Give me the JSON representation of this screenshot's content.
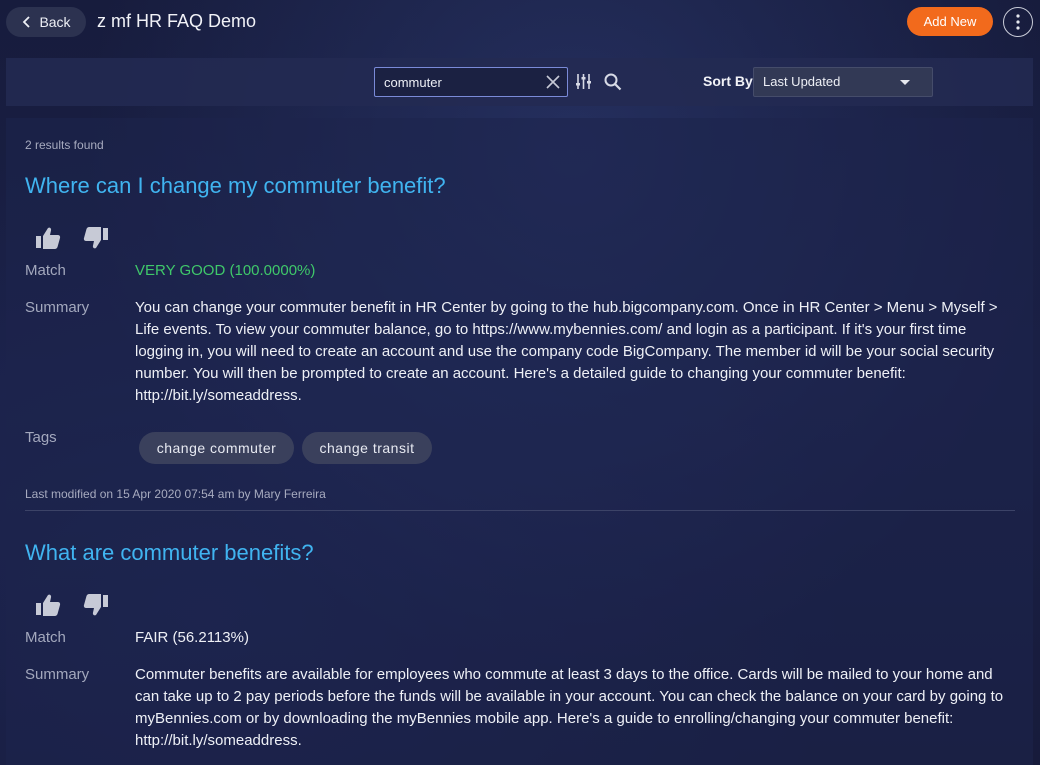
{
  "header": {
    "back_label": "Back",
    "title": "z mf HR FAQ Demo",
    "add_new_label": "Add New"
  },
  "toolbar": {
    "search_value": "commuter",
    "sort_by_label": "Sort By",
    "sort_value": "Last Updated"
  },
  "results": {
    "count_text": "2 results found",
    "items": [
      {
        "question": "Where can I change my commuter benefit?",
        "match_label": "Match",
        "match_value": "VERY GOOD (100.0000%)",
        "summary_label": "Summary",
        "summary": "You can change your commuter benefit in HR Center by going to the hub.bigcompany.com. Once in HR Center > Menu > Myself > Life events. To view your commuter balance, go to https://www.mybennies.com/ and login as a participant. If it's your first time logging in, you will need to create an account and use the company code BigCompany. The member id will be your social security number. You will then be prompted to create an account. Here's a detailed guide to changing your commuter benefit: http://bit.ly/someaddress.",
        "tags_label": "Tags",
        "tags": [
          "change commuter",
          "change transit"
        ],
        "modified": "Last modified on 15 Apr 2020 07:54 am by Mary Ferreira"
      },
      {
        "question": "What are commuter benefits?",
        "match_label": "Match",
        "match_value": "FAIR (56.2113%)",
        "summary_label": "Summary",
        "summary": "Commuter benefits are available for employees who commute at least 3 days to the office. Cards will be mailed to your home and can take up to 2 pay periods before the funds will be available in your account. You can check the balance on your card by going to myBennies.com or by downloading the myBennies mobile app. Here's a guide to enrolling/changing your commuter benefit: http://bit.ly/someaddress."
      }
    ]
  },
  "colors": {
    "accent_orange": "#f26a1c",
    "link_blue": "#40b4f0",
    "match_good_green": "#3fc86a"
  }
}
